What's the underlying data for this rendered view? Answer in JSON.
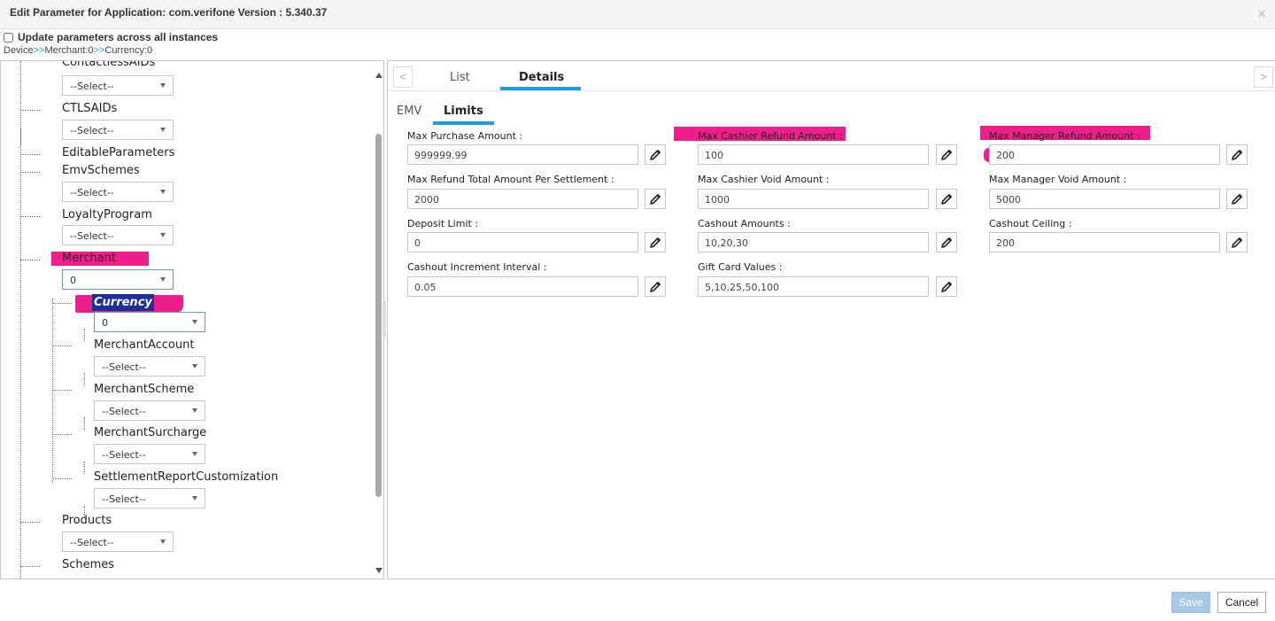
{
  "window": {
    "title": "Edit Parameter for Application: com.verifone Version : 5.340.37",
    "close_glyph": "×"
  },
  "update_all": {
    "label": "Update parameters across all instances",
    "checked": false
  },
  "breadcrumb": {
    "part1": "Device",
    "sep1": ">>",
    "part2": "Merchant:0",
    "sep2": ">>",
    "part3": "Currency:0"
  },
  "tree": {
    "nodes": [
      {
        "label": "ContactlessAIDs",
        "value": "--Select--"
      },
      {
        "label": "CTLSAIDs",
        "value": "--Select--"
      },
      {
        "label": "EditableParameters"
      },
      {
        "label": "EmvSchemes",
        "value": "--Select--"
      },
      {
        "label": "LoyaltyProgram",
        "value": "--Select--"
      },
      {
        "label": "Merchant",
        "value": "0"
      },
      {
        "label": "Currency",
        "value": "0"
      },
      {
        "label": "MerchantAccount",
        "value": "--Select--"
      },
      {
        "label": "MerchantScheme",
        "value": "--Select--"
      },
      {
        "label": "MerchantSurcharge",
        "value": "--Select--"
      },
      {
        "label": "SettlementReportCustomization",
        "value": "--Select--"
      },
      {
        "label": "Products",
        "value": "--Select--"
      },
      {
        "label": "Schemes"
      }
    ]
  },
  "tabs": {
    "list": "List",
    "details": "Details",
    "prev_glyph": "<",
    "next_glyph": ">"
  },
  "subtabs": {
    "emv": "EMV",
    "limits": "Limits"
  },
  "fields": [
    {
      "label": "Max Purchase Amount :",
      "value": "999999.99"
    },
    {
      "label": "Max Cashier Refund Amount :",
      "value": "100"
    },
    {
      "label": "Max Manager Refund Amount :",
      "value": "200"
    },
    {
      "label": "Max Refund Total Amount Per Settlement :",
      "value": "2000"
    },
    {
      "label": "Max Cashier Void Amount :",
      "value": "1000"
    },
    {
      "label": "Max Manager Void Amount :",
      "value": "5000"
    },
    {
      "label": "Deposit Limit :",
      "value": "0"
    },
    {
      "label": "Cashout Amounts :",
      "value": "10,20,30"
    },
    {
      "label": "Cashout Ceiling :",
      "value": "200"
    },
    {
      "label": "Cashout Increment Interval :",
      "value": "0.05"
    },
    {
      "label": "Gift Card Values :",
      "value": "5,10,25,50,100"
    }
  ],
  "buttons": {
    "save": "Save",
    "cancel": "Cancel"
  },
  "colors": {
    "highlight": "#ee1e8a",
    "accent": "#1aa0e0",
    "selection": "#1d2e9a",
    "save_disabled": "#a8c8e8"
  }
}
